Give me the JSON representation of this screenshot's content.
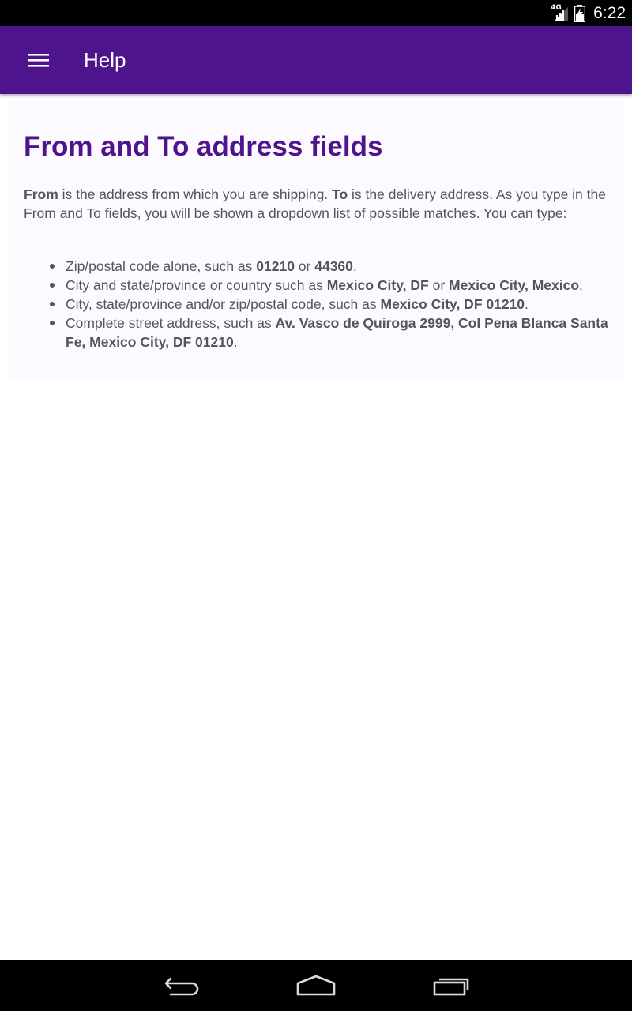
{
  "status_bar": {
    "network_label": "4G",
    "time": "6:22",
    "icons": [
      "signal-icon",
      "battery-icon"
    ]
  },
  "app_bar": {
    "title": "Help",
    "menu_icon": "menu-icon",
    "background_color": "#4d148c"
  },
  "content": {
    "heading": "From and To address fields",
    "heading_color": "#4d148c",
    "intro": {
      "from_label": "From",
      "from_text": " is the address from which you are shipping. ",
      "to_label": "To",
      "to_text": " is the delivery address. As you type in the From and To fields, you will be shown a dropdown list of possible matches. You can type:"
    },
    "bullets": [
      {
        "text1": "Zip/postal code alone, such as ",
        "bold1": "01210",
        "text2": " or ",
        "bold2": "44360",
        "text3": "."
      },
      {
        "text1": "City and state/province or country such as ",
        "bold1": "Mexico City, DF",
        "text2": " or ",
        "bold2": "Mexico City, Mexico",
        "text3": "."
      },
      {
        "text1": "City, state/province and/or zip/postal code, such as ",
        "bold1": "Mexico City, DF 01210",
        "text2": "."
      },
      {
        "text1": "Complete street address, such as ",
        "bold1": "Av. Vasco de Quiroga 2999, Col Pena Blanca Santa Fe, Mexico City, DF 01210",
        "text2": "."
      }
    ]
  },
  "nav_bar": {
    "icons": [
      "back-icon",
      "home-icon",
      "recent-apps-icon"
    ]
  }
}
